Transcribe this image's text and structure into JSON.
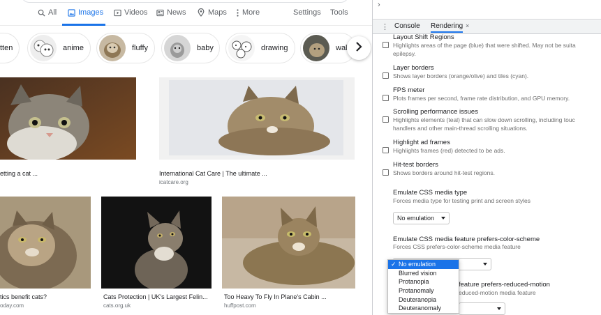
{
  "search": {
    "tabs": [
      {
        "label": "All",
        "icon": "search-icon"
      },
      {
        "label": "Images",
        "icon": "image-icon",
        "active": true
      },
      {
        "label": "Videos",
        "icon": "video-icon"
      },
      {
        "label": "News",
        "icon": "news-icon"
      },
      {
        "label": "Maps",
        "icon": "map-pin-icon"
      },
      {
        "label": "More",
        "icon": "more-vertical-icon"
      }
    ],
    "settings_label": "Settings",
    "tools_label": "Tools",
    "chips": [
      "tten",
      "anime",
      "fluffy",
      "baby",
      "drawing",
      "wall"
    ],
    "results": [
      {
        "caption": "etting a cat ...",
        "source": ""
      },
      {
        "caption": "International Cat Care | The ultimate ...",
        "source": "icatcare.org"
      },
      {
        "caption": "tics benefit cats?",
        "source": "oday.com"
      },
      {
        "caption": "Cats Protection | UK's Largest Felin...",
        "source": "cats.org.uk"
      },
      {
        "caption": "Too Heavy To Fly In Plane's Cabin ...",
        "source": "huffpost.com"
      }
    ]
  },
  "devtools": {
    "tabs": {
      "console": "Console",
      "rendering": "Rendering",
      "close": "×"
    },
    "options": [
      {
        "title": "Layout Shift Regions",
        "desc": [
          "Highlights areas of the page (blue) that were shifted. May not be suita",
          "epilepsy."
        ],
        "desc_first_line": "Highlights areas of the page (blue) that were shifted. May not be suita",
        "desc_second_line": "epilepsy."
      },
      {
        "title": "Layer borders",
        "desc_first_line": "Shows layer borders (orange/olive) and tiles (cyan).",
        "desc_second_line": ""
      },
      {
        "title": "FPS meter",
        "desc_first_line": "Plots frames per second, frame rate distribution, and GPU memory.",
        "desc_second_line": ""
      },
      {
        "title": "Scrolling performance issues",
        "desc_first_line": "Highlights elements (teal) that can slow down scrolling, including touc",
        "desc_second_line": "handlers and other main-thread scrolling situations."
      },
      {
        "title": "Highlight ad frames",
        "desc_first_line": "Highlights frames (red) detected to be ads.",
        "desc_second_line": ""
      },
      {
        "title": "Hit-test borders",
        "desc_first_line": "Shows borders around hit-test regions.",
        "desc_second_line": ""
      }
    ],
    "media_type": {
      "title": "Emulate CSS media type",
      "desc": "Forces media type for testing print and screen styles",
      "value": "No emulation"
    },
    "color_scheme": {
      "title": "Emulate CSS media feature prefers-color-scheme",
      "desc": "Forces CSS prefers-color-scheme media feature"
    },
    "reduced_motion": {
      "title_visible": "feature prefers-reduced-motion",
      "desc_visible": "educed-motion media feature"
    },
    "vision_dropdown": {
      "check": "✓",
      "options": [
        "No emulation",
        "Blurred vision",
        "Protanopia",
        "Protanomaly",
        "Deuteranopia",
        "Deuteranomaly"
      ],
      "selected_index": 0
    }
  },
  "colors": {
    "accent": "#1a73e8",
    "text": "#202124",
    "muted": "#70757a"
  }
}
